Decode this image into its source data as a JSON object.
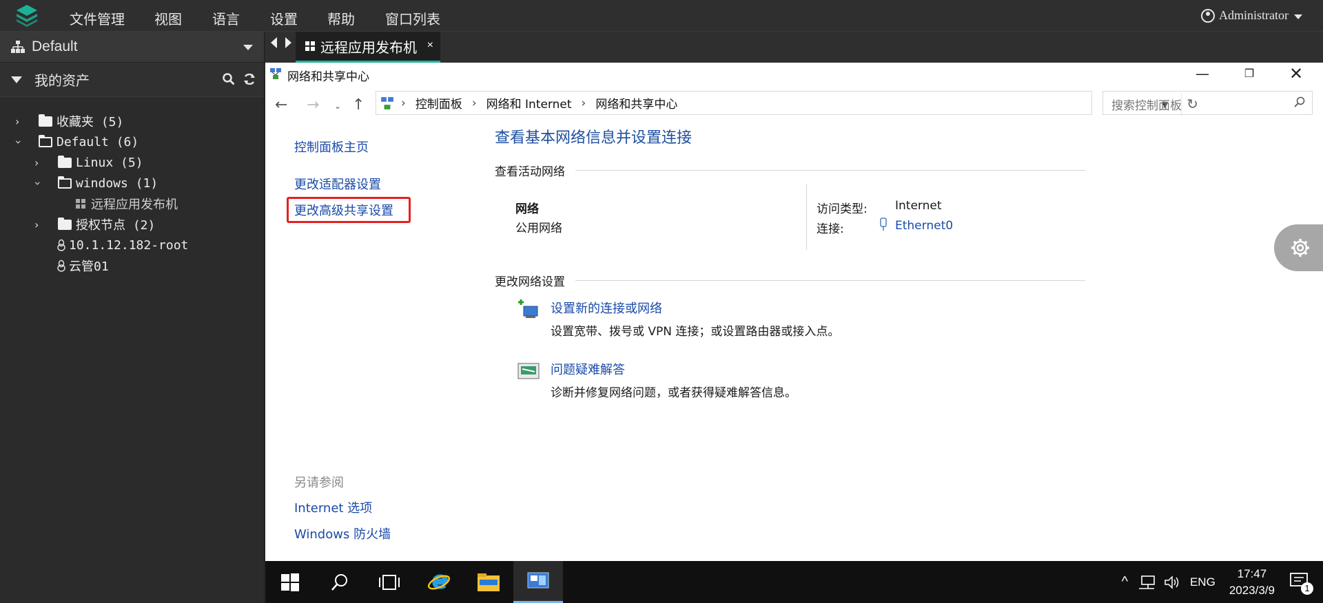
{
  "menu": {
    "items": [
      "文件管理",
      "视图",
      "语言",
      "设置",
      "帮助",
      "窗口列表"
    ],
    "user": "Administrator"
  },
  "sidebar": {
    "workspace": "Default",
    "assets_title": "我的资产",
    "tree": [
      {
        "label": "收藏夹 (5)",
        "expanded": false,
        "icon": "folder-icon"
      },
      {
        "label": "Default (6)",
        "expanded": true,
        "icon": "folder-open-icon"
      },
      {
        "label": "Linux (5)",
        "expanded": false,
        "icon": "folder-icon"
      },
      {
        "label": "windows (1)",
        "expanded": true,
        "icon": "folder-open-icon"
      },
      {
        "label": "远程应用发布机",
        "icon": "windows-icon"
      },
      {
        "label": "授权节点 (2)",
        "expanded": false,
        "icon": "folder-icon"
      },
      {
        "label": "10.1.12.182-root",
        "icon": "linux-icon"
      },
      {
        "label": "云管01",
        "icon": "linux-icon"
      }
    ]
  },
  "tab": {
    "label": "远程应用发布机",
    "close": "×"
  },
  "window": {
    "title": "网络和共享中心",
    "breadcrumbs": [
      "控制面板",
      "网络和 Internet",
      "网络和共享中心"
    ],
    "search_placeholder": "搜索控制面板",
    "left_links": [
      "控制面板主页",
      "更改适配器设置",
      "更改高级共享设置"
    ],
    "see_also_title": "另请参阅",
    "see_also": [
      "Internet 选项",
      "Windows 防火墙"
    ],
    "main_title": "查看基本网络信息并设置连接",
    "active_networks_title": "查看活动网络",
    "network_name": "网络",
    "network_type": "公用网络",
    "access_type_label": "访问类型:",
    "access_type_value": "Internet",
    "connection_label": "连接:",
    "connection_value": "Ethernet0",
    "change_settings_title": "更改网络设置",
    "actions": [
      {
        "title": "设置新的连接或网络",
        "desc": "设置宽带、拨号或 VPN 连接；或设置路由器或接入点。"
      },
      {
        "title": "问题疑难解答",
        "desc": "诊断并修复网络问题，或者获得疑难解答信息。"
      }
    ]
  },
  "taskbar": {
    "lang": "ENG",
    "time": "17:47",
    "date": "2023/3/9",
    "notification_count": "1"
  },
  "colors": {
    "accent": "#1ab394",
    "link": "#1a4aa8",
    "highlight_box": "#e81e1e"
  }
}
